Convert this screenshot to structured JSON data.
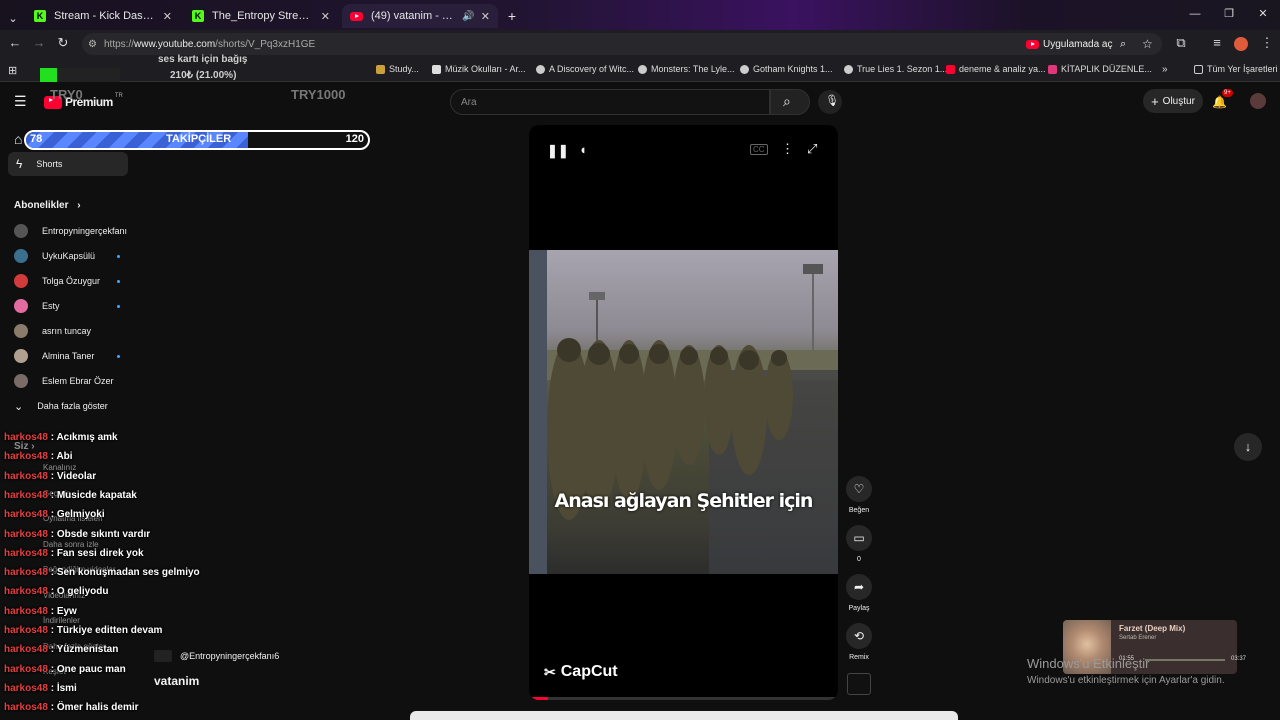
{
  "tabs": [
    {
      "title": "Stream - Kick Dashboard",
      "icon": "kick-icon"
    },
    {
      "title": "The_Entropy Stream - Watch Li",
      "icon": "kick-icon"
    },
    {
      "title": "(49) vatanim - YouTube",
      "icon": "youtube-icon"
    }
  ],
  "address": {
    "prefix": "https://",
    "domain": "www.youtube.com",
    "path": "/shorts/V_Pq3xzH1GE",
    "open_in_app": "Uygulamada aç"
  },
  "bookmarks": [
    "Study...",
    "Müzik Okulları - Ar...",
    "A Discovery of Witc...",
    "Monsters: The Lyle...",
    "Gotham Knights 1...",
    "True Lies 1. Sezon 1...",
    "deneme & analiz ya...",
    "KİTAPLIK DÜZENLE...",
    "Tüm Yer İşaretleri"
  ],
  "overlay": {
    "donation_title": "ses kartı için bağış",
    "donation_amount": "210₺ (21.00%)",
    "donation_progress": 0.21,
    "try_left": "TRY0",
    "try_right": "TRY1000",
    "followers_label": "TAKİPÇİLER",
    "followers_current": "78",
    "followers_goal": "120",
    "followers_progress": 0.65
  },
  "youtube": {
    "brand": "Premium",
    "region": "TR",
    "search_placeholder": "Ara",
    "create_label": "Oluştur",
    "notif_count": "9+"
  },
  "sidebar": {
    "shorts": "Shorts",
    "subscriptions_header": "Abonelikler",
    "channels": [
      {
        "name": "Entropyningerçekfanı",
        "color": "#555",
        "dot": false
      },
      {
        "name": "UykuKapsülü",
        "color": "#3a6f8f",
        "dot": true
      },
      {
        "name": "Tolga Özuygur",
        "color": "#d23b3b",
        "dot": true
      },
      {
        "name": "Esty",
        "color": "#e26ca0",
        "dot": true
      },
      {
        "name": "asrın tuncay",
        "color": "#8a7b6a",
        "dot": false
      },
      {
        "name": "Almina Taner",
        "color": "#b0a090",
        "dot": true
      },
      {
        "name": "Eslem Ebrar Özer",
        "color": "#7a6b66",
        "dot": false
      }
    ],
    "show_more": "Daha fazla göster",
    "you": "Siz",
    "under_items": [
      "Kanalınız",
      "Geçmiş",
      "Oynatma listeleri",
      "Daha sonra izle",
      "Beğendiğim videolar",
      "Videolarınız",
      "İndirilenler",
      "Daha fazla göster",
      "Keşfet"
    ]
  },
  "video": {
    "subtitle": "Anası ağlayan Şehitler için",
    "watermark": "CapCut",
    "channel_handle": "@Entropyningerçekfanı6",
    "title": "vatanim"
  },
  "actions": {
    "like": "Beğen",
    "comments": "0",
    "share": "Paylaş",
    "remix": "Remix"
  },
  "chat": [
    {
      "user": "harkos48",
      "msg": "Acıkmış amk"
    },
    {
      "user": "harkos48",
      "msg": "Abi"
    },
    {
      "user": "harkos48",
      "msg": "Videolar"
    },
    {
      "user": "harkos48",
      "msg": "Musicde kapatak"
    },
    {
      "user": "harkos48",
      "msg": "Gelmiyoki"
    },
    {
      "user": "harkos48",
      "msg": "Obsde sıkıntı vardır"
    },
    {
      "user": "harkos48",
      "msg": "Fan sesi direk yok"
    },
    {
      "user": "harkos48",
      "msg": "Sen konuşmadan ses gelmiyo"
    },
    {
      "user": "harkos48",
      "msg": "O geliyodu"
    },
    {
      "user": "harkos48",
      "msg": "Eyw"
    },
    {
      "user": "harkos48",
      "msg": "Türkiye editten devam"
    },
    {
      "user": "harkos48",
      "msg": "Yüzmenistan"
    },
    {
      "user": "harkos48",
      "msg": "One pauc man"
    },
    {
      "user": "harkos48",
      "msg": "İsmi"
    },
    {
      "user": "harkos48",
      "msg": "Ömer halis demir"
    }
  ],
  "music": {
    "title": "Farzet (Deep Mix)",
    "artist": "Sertab Erener",
    "elapsed": "01:55",
    "total": "03:37"
  },
  "windows": {
    "line1": "Windows'u Etkinleştir",
    "line2": "Windows'u etkinleştirmek için Ayarlar'a gidin."
  },
  "colors": {
    "accent_red": "#ff0033",
    "kick_green": "#53fc18",
    "chat_user": "#e34040"
  }
}
